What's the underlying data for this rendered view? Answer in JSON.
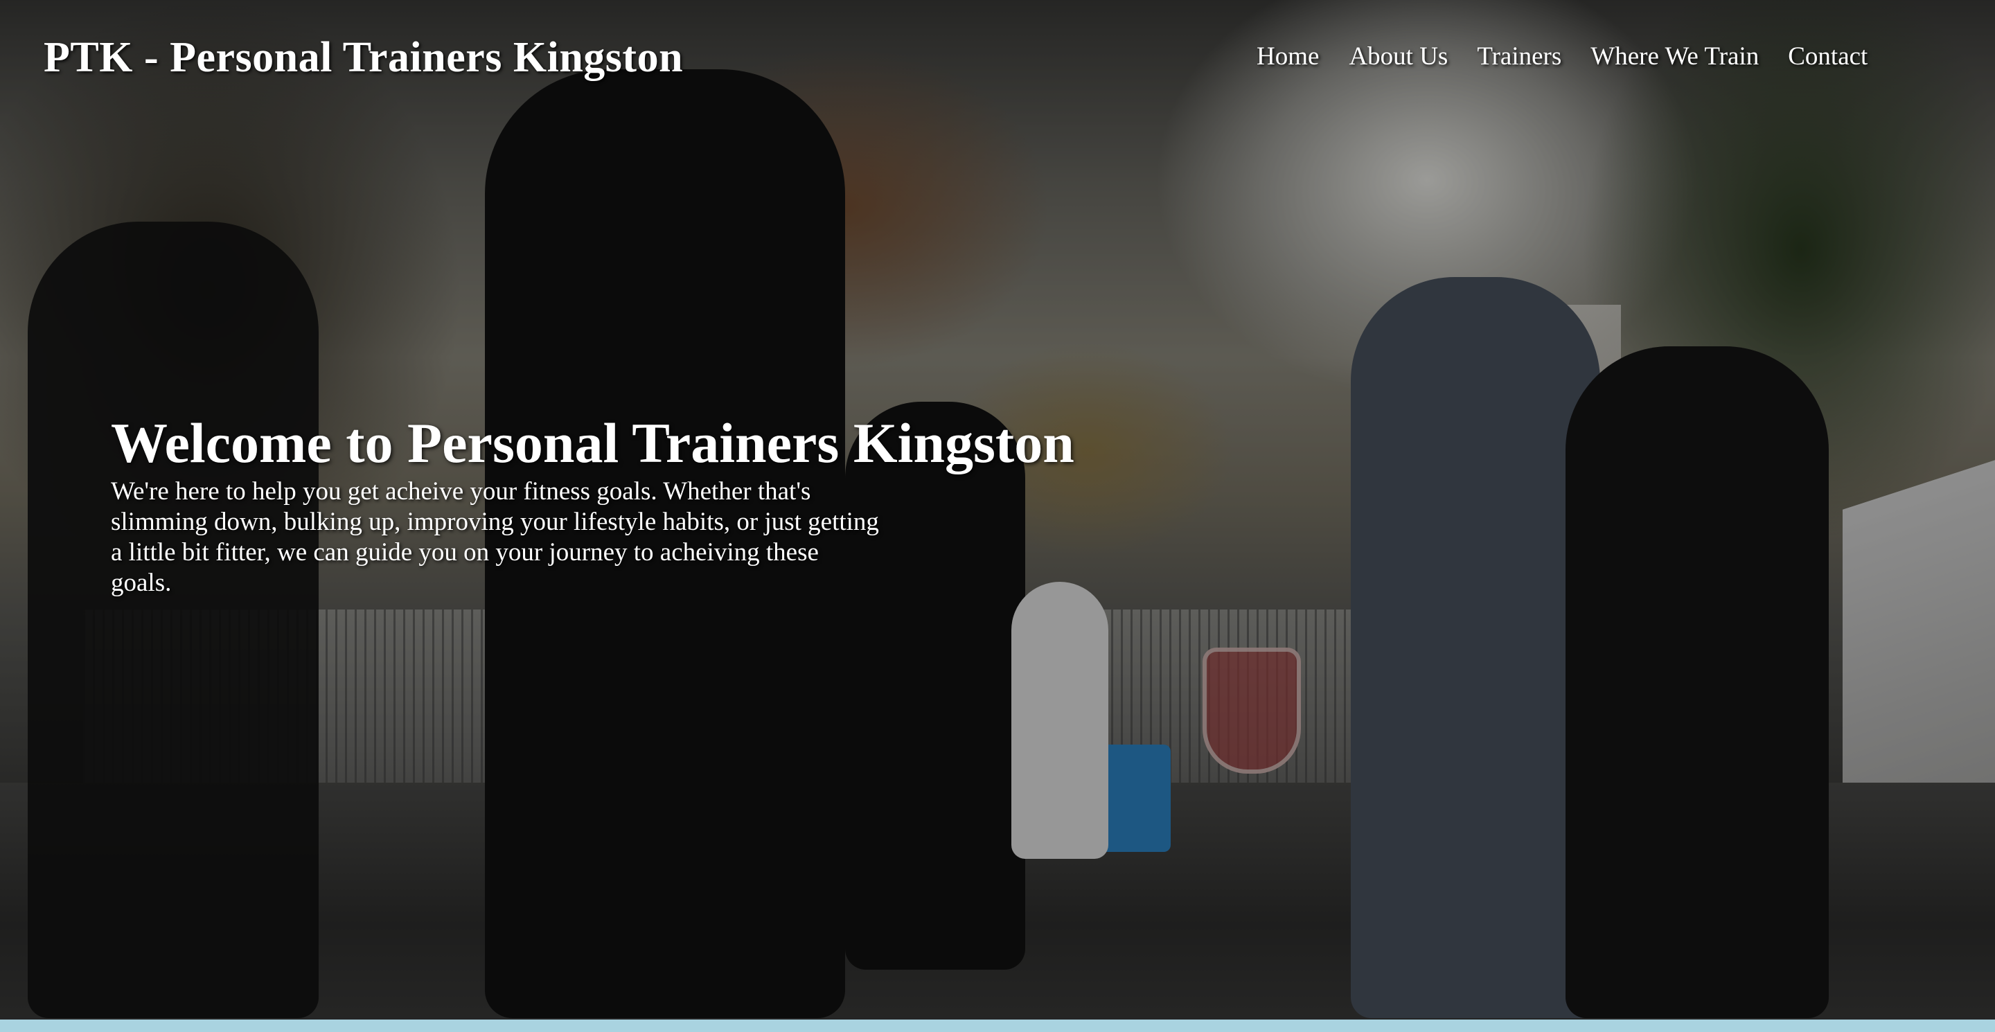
{
  "header": {
    "site_title": "PTK - Personal Trainers Kingston"
  },
  "nav": {
    "items": [
      {
        "label": "Home"
      },
      {
        "label": "About Us"
      },
      {
        "label": "Trainers"
      },
      {
        "label": "Where We Train"
      },
      {
        "label": "Contact"
      }
    ]
  },
  "hero": {
    "heading": "Welcome to Personal Trainers Kingston",
    "body": "We're here to help you get acheive your fitness goals. Whether that's slimming down, bulking up, improving your lifestyle habits, or just getting a little bit fitter, we can guide you on your journey to acheiving these goals."
  },
  "colors": {
    "text": "#ffffff",
    "bottom_bar": "#a9d3e0"
  }
}
